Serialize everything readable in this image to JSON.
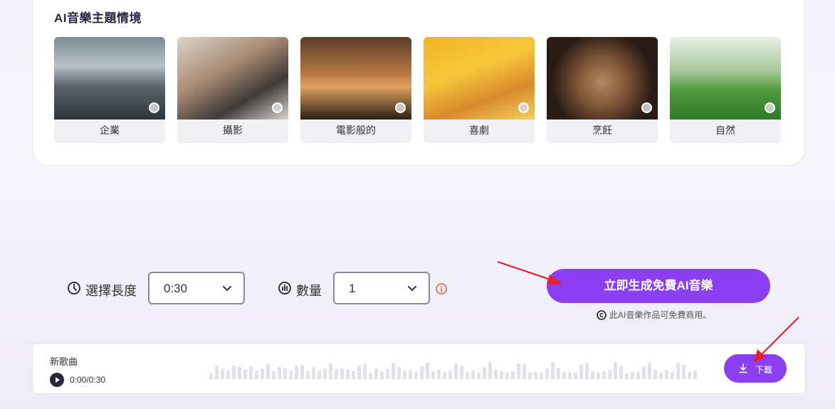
{
  "theme_section": {
    "title": "AI音樂主題情境",
    "tiles": [
      {
        "label": "企業",
        "icon": "city-skyline-image"
      },
      {
        "label": "攝影",
        "icon": "camera-desk-image"
      },
      {
        "label": "電影般的",
        "icon": "cinematic-ufo-image"
      },
      {
        "label": "喜劇",
        "icon": "cat-hammock-image"
      },
      {
        "label": "烹飪",
        "icon": "food-ingredients-image"
      },
      {
        "label": "自然",
        "icon": "green-forest-image"
      }
    ]
  },
  "controls": {
    "length_label": "選擇長度",
    "length_value": "0:30",
    "count_label": "數量",
    "count_value": "1",
    "generate_label": "立即生成免費AI音樂",
    "license_note": "此AI音樂作品可免費商用。"
  },
  "player": {
    "title": "新歌曲",
    "time": "0:00/0:30",
    "download_label": "下載"
  },
  "colors": {
    "accent": "#8a3ff2",
    "annotation_arrow": "#e8202a",
    "info": "#e8643a"
  }
}
